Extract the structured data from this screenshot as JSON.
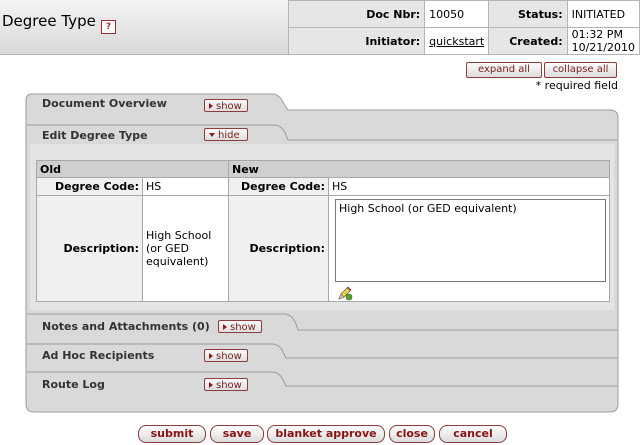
{
  "header": {
    "title": "Degree Type",
    "help_glyph": "?",
    "doc_nbr_label": "Doc Nbr:",
    "doc_nbr": "10050",
    "status_label": "Status:",
    "status": "INITIATED",
    "initiator_label": "Initiator:",
    "initiator": "quickstart",
    "created_label": "Created:",
    "created": "01:32 PM 10/21/2010"
  },
  "controls": {
    "expand_all": "expand all",
    "collapse_all": "collapse all",
    "required_note": "* required field"
  },
  "tabs": {
    "document_overview": {
      "label": "Document Overview",
      "toggle": "show"
    },
    "edit_degree_type": {
      "label": "Edit Degree Type",
      "toggle": "hide"
    },
    "notes": {
      "label": "Notes and Attachments (0)",
      "toggle": "show"
    },
    "ad_hoc": {
      "label": "Ad Hoc Recipients",
      "toggle": "show"
    },
    "route_log": {
      "label": "Route Log",
      "toggle": "show"
    }
  },
  "edit": {
    "old_header": "Old",
    "new_header": "New",
    "degree_code_label": "Degree Code:",
    "old_degree_code": "HS",
    "new_degree_code": "HS",
    "description_label": "Description:",
    "old_description": "High School (or GED equivalent)",
    "new_description": "High School (or GED equivalent)"
  },
  "actions": {
    "submit": "submit",
    "save": "save",
    "blanket_approve": "blanket approve",
    "close": "close",
    "cancel": "cancel"
  },
  "icons": {
    "help": "help-icon",
    "pencil": "pencil-icon"
  }
}
